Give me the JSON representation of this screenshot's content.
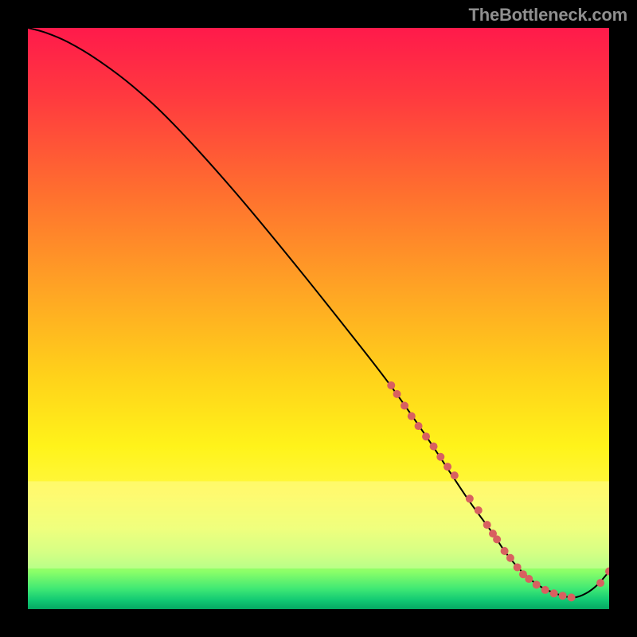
{
  "attribution": "TheBottleneck.com",
  "chart_data": {
    "type": "line",
    "title": "",
    "xlabel": "",
    "ylabel": "",
    "xlim": [
      0,
      100
    ],
    "ylim": [
      0,
      100
    ],
    "grid": false,
    "legend": false,
    "series": [
      {
        "name": "bottleneck-curve",
        "color": "#000000",
        "x": [
          0,
          3,
          7,
          12,
          18,
          25,
          35,
          45,
          55,
          62,
          68,
          72,
          76,
          80,
          82,
          84,
          86,
          88,
          90,
          92,
          94,
          96,
          98,
          100
        ],
        "y": [
          100,
          99.2,
          97.5,
          94.5,
          90,
          83.5,
          72.5,
          60.5,
          48,
          39,
          30.5,
          24.5,
          18.5,
          13,
          10,
          7.5,
          5.5,
          4,
          3,
          2.3,
          2,
          2.7,
          4.2,
          6.5
        ]
      }
    ],
    "focus_region_frac": {
      "y_start": 0.07,
      "y_end": 0.22
    },
    "points": {
      "name": "component-markers",
      "color": "#d86060",
      "radius": 5,
      "x": [
        62.5,
        63.5,
        64.8,
        66.0,
        67.2,
        68.5,
        69.8,
        71.0,
        72.2,
        73.4,
        76.0,
        77.5,
        79.0,
        80.0,
        80.7,
        82.0,
        83.0,
        84.2,
        85.2,
        86.2,
        87.5,
        89.0,
        90.5,
        92.0,
        93.5,
        98.5,
        100.0
      ],
      "y": [
        38.5,
        37.0,
        35.0,
        33.2,
        31.5,
        29.7,
        28.0,
        26.2,
        24.5,
        23.0,
        19.0,
        17.0,
        14.5,
        13.0,
        12.0,
        10.0,
        8.8,
        7.2,
        6.0,
        5.2,
        4.2,
        3.3,
        2.7,
        2.3,
        2.0,
        4.5,
        6.5
      ]
    }
  }
}
